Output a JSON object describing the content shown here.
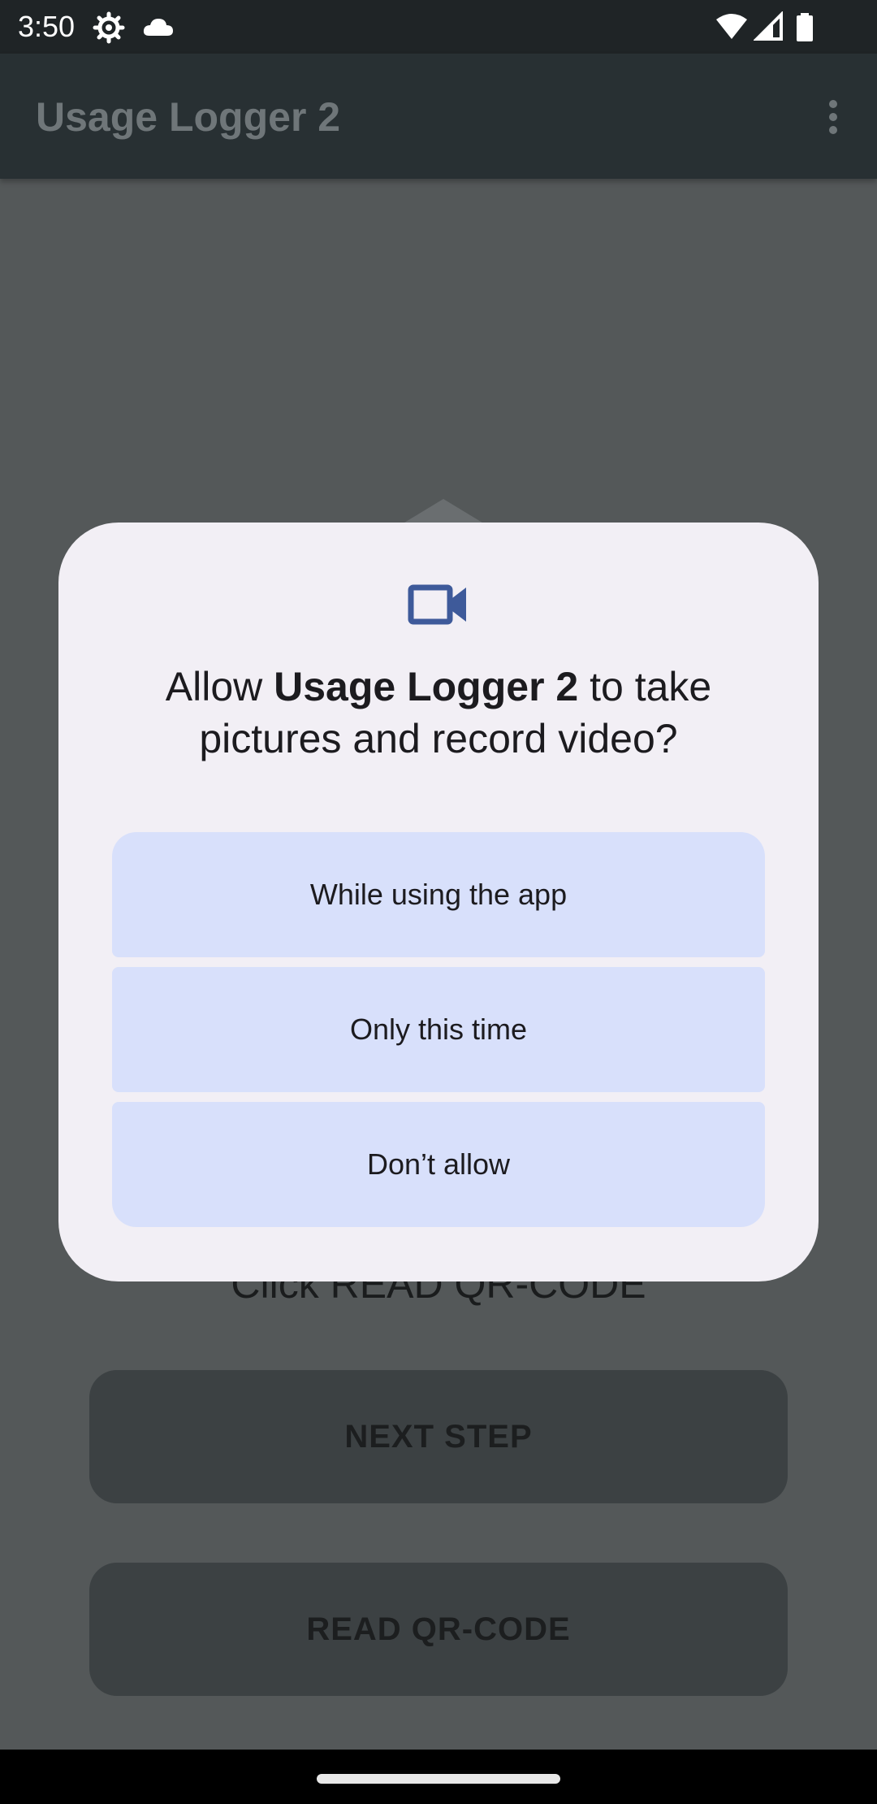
{
  "status_bar": {
    "time": "3:50",
    "icons": [
      "settings-icon",
      "cloud-icon",
      "wifi-icon",
      "signal-icon",
      "battery-icon"
    ]
  },
  "app_bar": {
    "title": "Usage Logger 2",
    "menu_icon": "more-vert-icon"
  },
  "main": {
    "instruction": "Click READ QR-CODE",
    "next_step_label": "NEXT STEP",
    "read_qr_label": "READ QR-CODE"
  },
  "dialog": {
    "icon": "videocam-icon",
    "title_prefix": "Allow ",
    "title_app": "Usage Logger 2",
    "title_suffix": " to take pictures and record video?",
    "buttons": [
      {
        "label": "While using the app"
      },
      {
        "label": "Only this time"
      },
      {
        "label": "Don’t allow"
      }
    ]
  },
  "colors": {
    "dialog_bg": "#f2eff5",
    "button_bg": "#d8e0fb",
    "icon_accent": "#3e5a9a",
    "scrim_bg": "#545859"
  }
}
